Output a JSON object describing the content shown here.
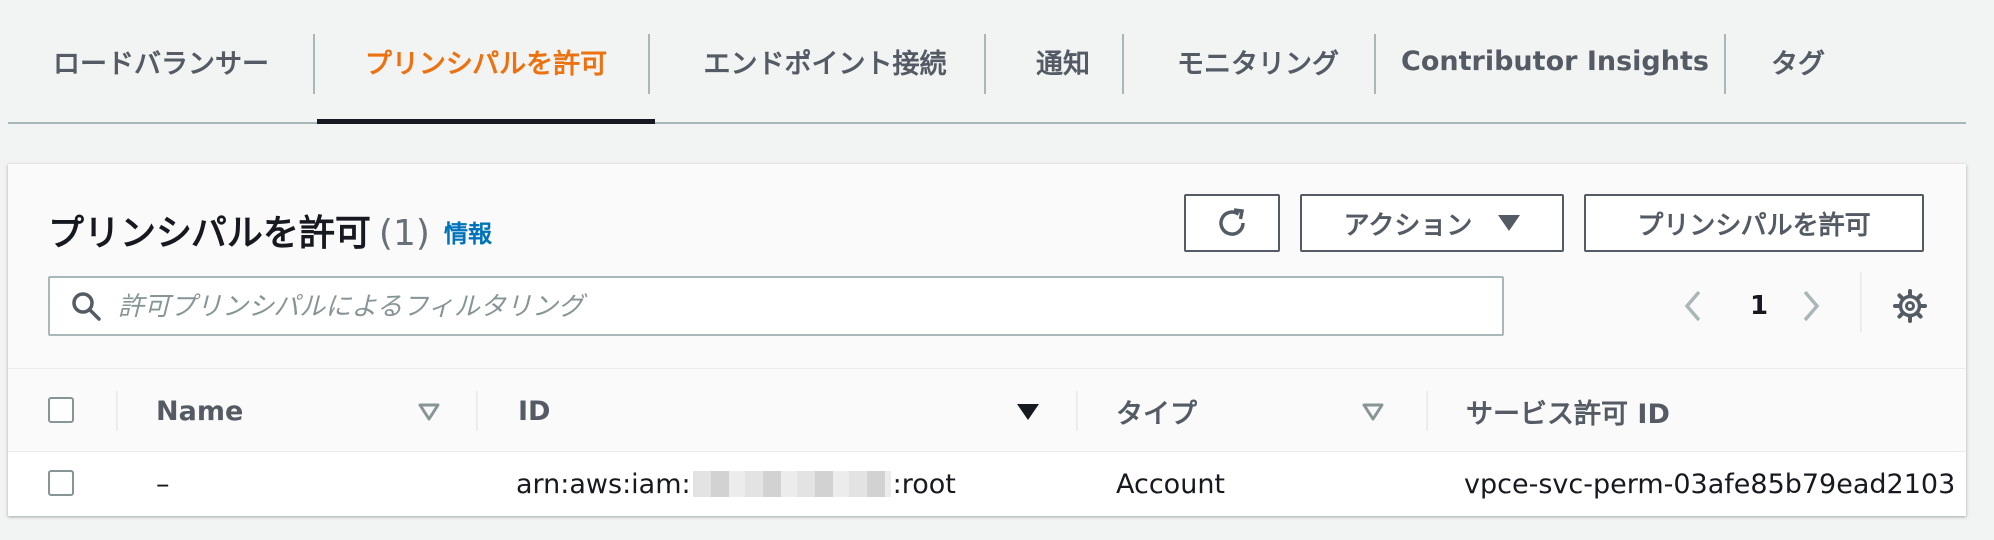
{
  "tabs": [
    {
      "label": "ロードバランサー",
      "active": false
    },
    {
      "label": "プリンシパルを許可",
      "active": true
    },
    {
      "label": "エンドポイント接続",
      "active": false
    },
    {
      "label": "通知",
      "active": false
    },
    {
      "label": "モニタリング",
      "active": false
    },
    {
      "label": "Contributor Insights",
      "active": false
    },
    {
      "label": "タグ",
      "active": false
    }
  ],
  "panel": {
    "title": "プリンシパルを許可",
    "count": "(1)",
    "info_link": "情報",
    "refresh_icon": "refresh-icon",
    "actions_label": "アクション",
    "allow_button_label": "プリンシパルを許可",
    "search": {
      "placeholder": "許可プリンシパルによるフィルタリング",
      "value": ""
    },
    "pagination": {
      "current_page": "1"
    }
  },
  "table": {
    "columns": [
      {
        "label": "Name",
        "sort": "sortable"
      },
      {
        "label": "ID",
        "sort": "descending"
      },
      {
        "label": "タイプ",
        "sort": "sortable"
      },
      {
        "label": "サービス許可 ID",
        "sort": "none"
      }
    ],
    "rows": [
      {
        "name": "–",
        "id_prefix": "arn:aws:iam:",
        "id_suffix": ":root",
        "type": "Account",
        "service_permission_id": "vpce-svc-perm-03afe85b79ead2103"
      }
    ]
  },
  "colors": {
    "active_tab": "#ec7211",
    "link": "#0073bb",
    "text": "#16191f",
    "muted": "#545b64"
  }
}
